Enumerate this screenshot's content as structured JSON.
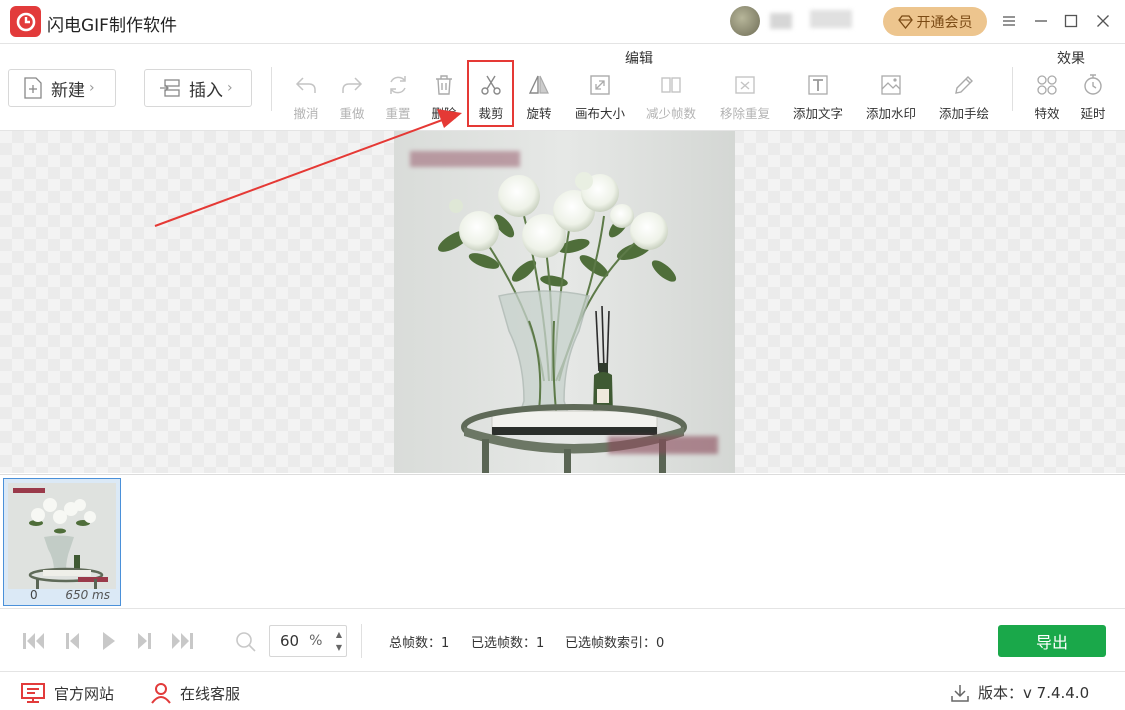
{
  "app": {
    "title": "闪电GIF制作软件"
  },
  "header": {
    "vip_label": "开通会员",
    "window_controls": [
      "menu-icon",
      "minimize-icon",
      "maximize-icon",
      "close-icon"
    ]
  },
  "toolbar": {
    "new_label": "新建",
    "insert_label": "插入",
    "edit_group_label": "编辑",
    "effects_group_label": "效果",
    "edit_tools": [
      {
        "label": "撤消",
        "icon": "undo-icon",
        "enabled": false
      },
      {
        "label": "重做",
        "icon": "redo-icon",
        "enabled": false
      },
      {
        "label": "重置",
        "icon": "reset-icon",
        "enabled": false
      },
      {
        "label": "删除",
        "icon": "trash-icon",
        "enabled": true
      },
      {
        "label": "裁剪",
        "icon": "scissors-icon",
        "enabled": true,
        "highlighted": true
      },
      {
        "label": "旋转",
        "icon": "rotate-icon",
        "enabled": true
      },
      {
        "label": "画布大小",
        "icon": "canvas-size-icon",
        "enabled": true
      },
      {
        "label": "减少帧数",
        "icon": "reduce-frames-icon",
        "enabled": false
      },
      {
        "label": "移除重复",
        "icon": "remove-duplicate-icon",
        "enabled": false
      },
      {
        "label": "添加文字",
        "icon": "text-icon",
        "enabled": true
      },
      {
        "label": "添加水印",
        "icon": "watermark-icon",
        "enabled": true
      },
      {
        "label": "添加手绘",
        "icon": "pencil-icon",
        "enabled": true
      }
    ],
    "effect_tools": [
      {
        "label": "特效",
        "icon": "effects-icon",
        "enabled": true
      },
      {
        "label": "延时",
        "icon": "timer-icon",
        "enabled": true
      }
    ]
  },
  "frames": {
    "items": [
      {
        "index": "0",
        "duration": "650 ms",
        "selected": true
      }
    ]
  },
  "playback": {
    "zoom_value": "60",
    "zoom_unit": "%",
    "total_frames_label": "总帧数：1",
    "selected_frames_label": "已选帧数：1",
    "selected_index_label": "已选帧数索引：0",
    "export_label": "导出"
  },
  "footer": {
    "website_label": "官方网站",
    "support_label": "在线客服",
    "version_label": "版本：v 7.4.4.0"
  },
  "colors": {
    "accent_red": "#e23b3b",
    "export_green": "#1aa84a",
    "vip_gold": "#edc58e",
    "highlight_box": "#e53935",
    "selection_blue": "#4a90d9"
  }
}
